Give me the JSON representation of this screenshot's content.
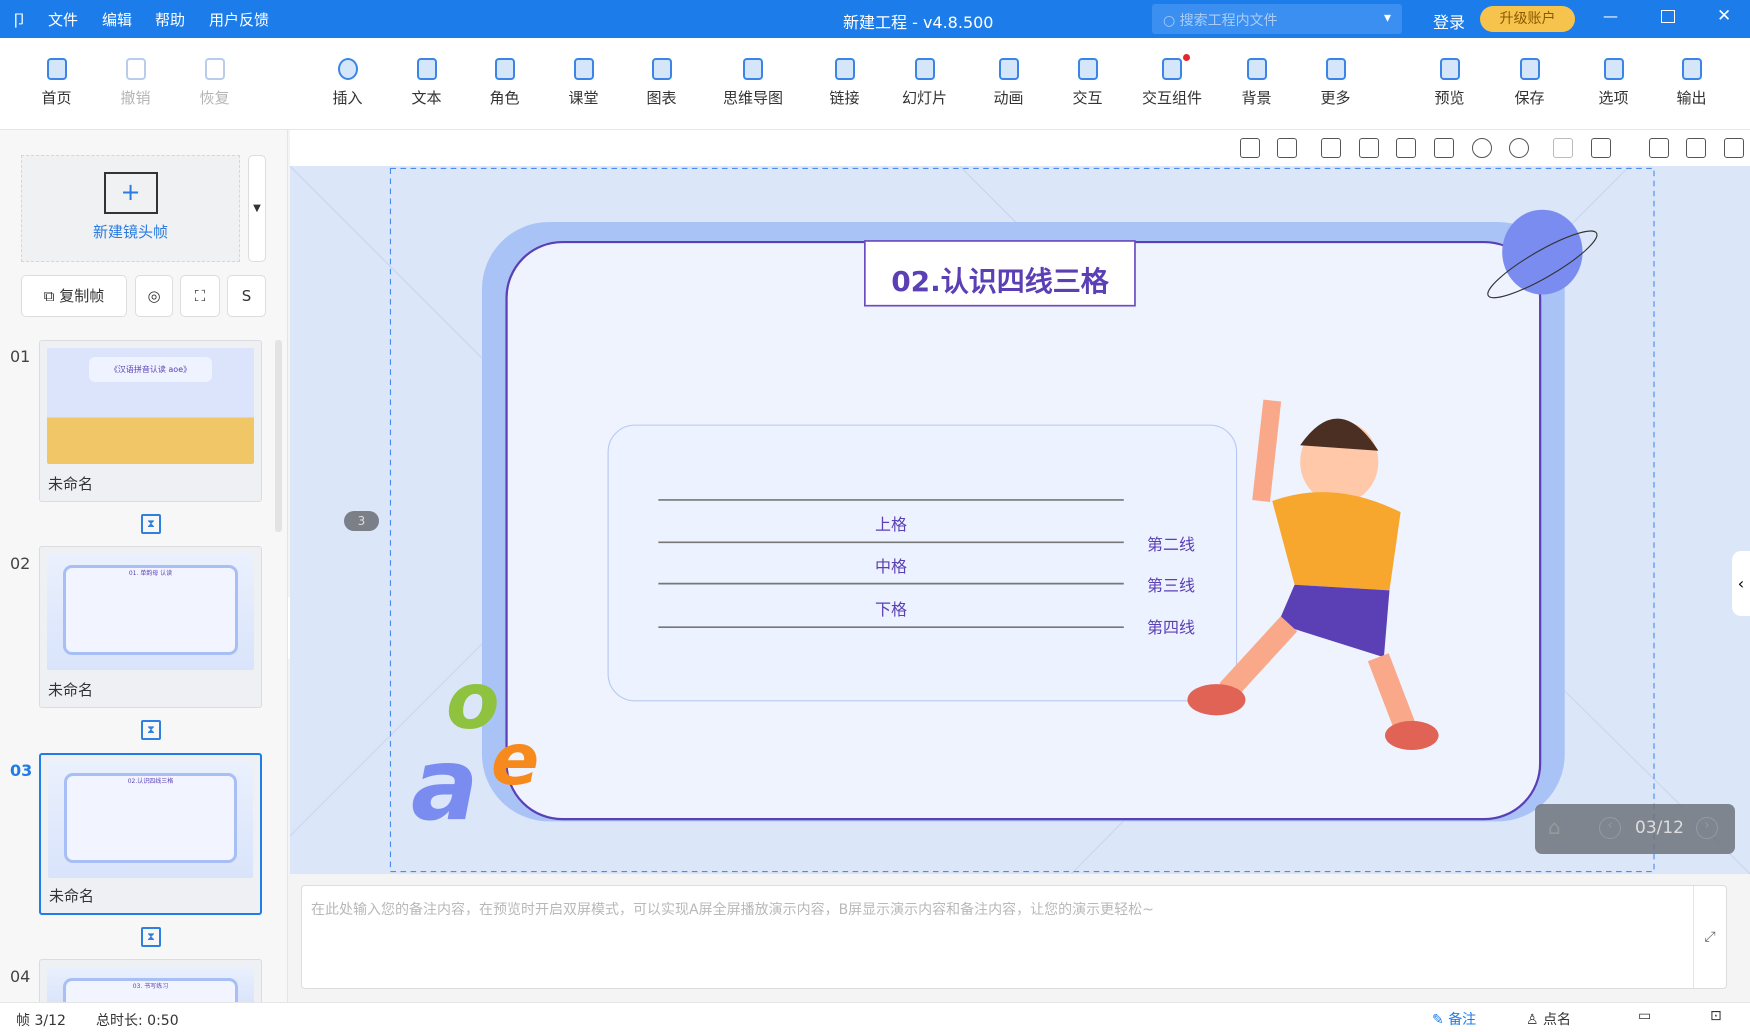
{
  "titlebar": {
    "menu": [
      "文件",
      "编辑",
      "帮助",
      "用户反馈"
    ],
    "title": "新建工程 - v4.8.500",
    "search_placeholder": "搜索工程内文件",
    "login": "登录",
    "upgrade": "升级账户"
  },
  "toolbar": {
    "items": [
      {
        "label": "首页"
      },
      {
        "label": "撤销",
        "disabled": true
      },
      {
        "label": "恢复",
        "disabled": true
      },
      {
        "label": "插入"
      },
      {
        "label": "文本"
      },
      {
        "label": "角色"
      },
      {
        "label": "课堂"
      },
      {
        "label": "图表"
      },
      {
        "label": "思维导图"
      },
      {
        "label": "链接"
      },
      {
        "label": "幻灯片"
      },
      {
        "label": "动画"
      },
      {
        "label": "交互"
      },
      {
        "label": "交互组件"
      },
      {
        "label": "背景"
      },
      {
        "label": "更多"
      },
      {
        "label": "预览"
      },
      {
        "label": "保存"
      },
      {
        "label": "选项"
      },
      {
        "label": "输出"
      }
    ]
  },
  "left": {
    "new_frame": "新建镜头帧",
    "copy_frame": "复制帧",
    "frames": [
      {
        "num": "01",
        "name": "未命名",
        "title": "《汉语拼音认读 aoe》"
      },
      {
        "num": "02",
        "name": "未命名",
        "title": "01. 单韵母 认读"
      },
      {
        "num": "03",
        "name": "未命名",
        "title": "02.认识四线三格"
      },
      {
        "num": "04",
        "name": "",
        "title": "03. 书写练习"
      }
    ]
  },
  "slide": {
    "title": "02.认识四线三格",
    "cells": [
      "上格",
      "中格",
      "下格"
    ],
    "lines": [
      "第二线",
      "第三线",
      "第四线"
    ],
    "letters": [
      "o",
      "a",
      "e"
    ],
    "marker": "3"
  },
  "nav": {
    "page": "03/12"
  },
  "notes": {
    "placeholder": "在此处输入您的备注内容，在预览时开启双屏模式，可以实现A屏全屏播放演示内容，B屏显示演示内容和备注内容，让您的演示更轻松~"
  },
  "status": {
    "frame": "帧 3/12",
    "duration": "总时长: 0:50",
    "notes": "备注",
    "rollcall": "点名"
  },
  "colors": {
    "brand": "#1c7ce9",
    "accent_purple": "#5b3fb5",
    "upgrade": "#f6c44c"
  }
}
